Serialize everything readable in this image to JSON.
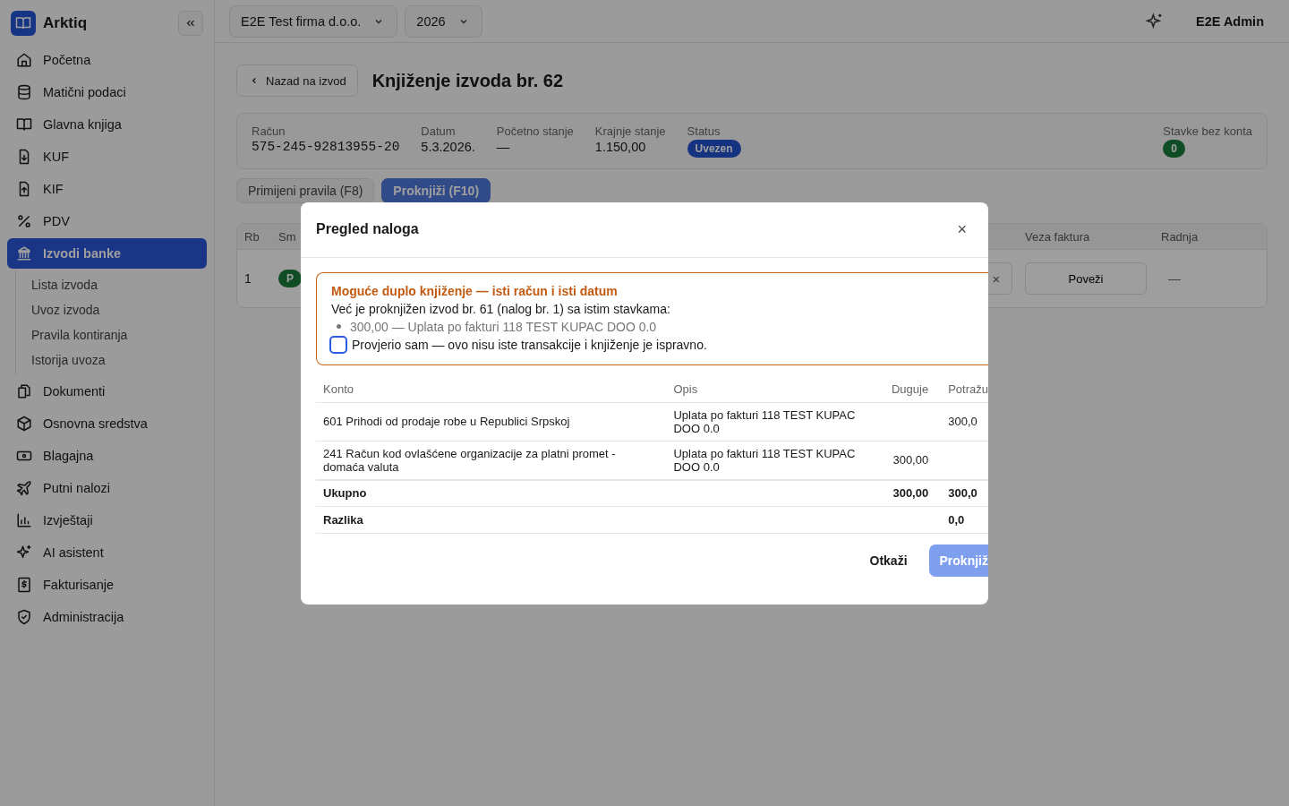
{
  "app": {
    "name": "Arktiq"
  },
  "sidebar": {
    "items": [
      {
        "label": "Početna",
        "kind": "home",
        "selected": false
      },
      {
        "label": "Matični podaci",
        "kind": "database",
        "selected": false
      },
      {
        "label": "Glavna knjiga",
        "kind": "book",
        "selected": false
      },
      {
        "label": "KUF",
        "kind": "file-down",
        "selected": false
      },
      {
        "label": "KIF",
        "kind": "file-up",
        "selected": false
      },
      {
        "label": "PDV",
        "kind": "percent",
        "selected": false
      },
      {
        "label": "Izvodi banke",
        "kind": "bank",
        "selected": true,
        "children": [
          {
            "label": "Lista izvoda"
          },
          {
            "label": "Uvoz izvoda"
          },
          {
            "label": "Pravila kontiranja"
          },
          {
            "label": "Istorija uvoza"
          }
        ]
      },
      {
        "label": "Dokumenti",
        "kind": "files",
        "selected": false
      },
      {
        "label": "Osnovna sredstva",
        "kind": "package",
        "selected": false
      },
      {
        "label": "Blagajna",
        "kind": "cash",
        "selected": false
      },
      {
        "label": "Putni nalozi",
        "kind": "plane",
        "selected": false
      },
      {
        "label": "Izvještaji",
        "kind": "chart",
        "selected": false
      },
      {
        "label": "AI asistent",
        "kind": "sparkle",
        "selected": false
      },
      {
        "label": "Fakturisanje",
        "kind": "invoice",
        "selected": false
      },
      {
        "label": "Administracija",
        "kind": "shield",
        "selected": false
      }
    ]
  },
  "topbar": {
    "company": "E2E Test firma d.o.o.",
    "year": "2026",
    "user": "E2E Admin"
  },
  "page": {
    "back": "Nazad na izvod",
    "title": "Knjiženje izvoda br. 62",
    "summary": [
      {
        "label": "Račun",
        "value": "575-245-92813955-20",
        "kind": "mono"
      },
      {
        "label": "Datum",
        "value": "5.3.2026.",
        "kind": "text"
      },
      {
        "label": "Početno stanje",
        "value": "—",
        "kind": "text"
      },
      {
        "label": "Krajnje stanje",
        "value": "1.150,00",
        "kind": "text"
      },
      {
        "label": "Status",
        "value": "Uvezen",
        "kind": "badge"
      }
    ],
    "unassigned": {
      "label": "Stavke bez konta",
      "value": "0"
    },
    "actions": [
      {
        "label": "Primijeni pravila (F8)",
        "kind": "secondary"
      },
      {
        "label": "Proknjiži (F10)",
        "kind": "primary"
      }
    ],
    "table": {
      "columns": [
        "Rb",
        "Sm",
        "Veza faktura",
        "Radnja"
      ],
      "rows": [
        {
          "rb": "1",
          "badge": "P",
          "clear": "×",
          "link": "Poveži",
          "action": "—"
        }
      ]
    }
  },
  "modal": {
    "title": "Pregled naloga",
    "close": "×",
    "warning": {
      "title": "Moguće duplo knjiženje — isti račun i isti datum",
      "text": "Već je proknjižen izvod br. 61 (nalog br. 1) sa istim stavkama:",
      "items": [
        "300,00 — Uplata po fakturi 118 TEST KUPAC DOO 0.0"
      ],
      "confirm": {
        "label": "Provjerio sam — ovo nisu iste transakcije i knjiženje je ispravno.",
        "checked": false
      }
    },
    "columns": [
      "Konto",
      "Opis",
      "Duguje",
      "Potražu"
    ],
    "rows": [
      {
        "konto": "601 Prihodi od prodaje robe u Republici Srpskoj",
        "opis": "Uplata po fakturi 118 TEST KUPAC DOO 0.0",
        "potrazuje": "300,0"
      },
      {
        "konto": "241 Račun kod ovlašćene organizacije za platni promet - domaća valuta",
        "opis": "Uplata po fakturi 118 TEST KUPAC DOO 0.0",
        "duguje": "300,00"
      }
    ],
    "totals": [
      {
        "label": "Ukupno",
        "duguje": "300,00",
        "potrazuje": "300,0"
      },
      {
        "label": "Razlika",
        "potrazuje": "0,0"
      }
    ],
    "buttons": [
      {
        "label": "Otkaži",
        "kind": "text"
      },
      {
        "label": "Proknjiž",
        "kind": "primary",
        "disabled": true
      }
    ]
  }
}
